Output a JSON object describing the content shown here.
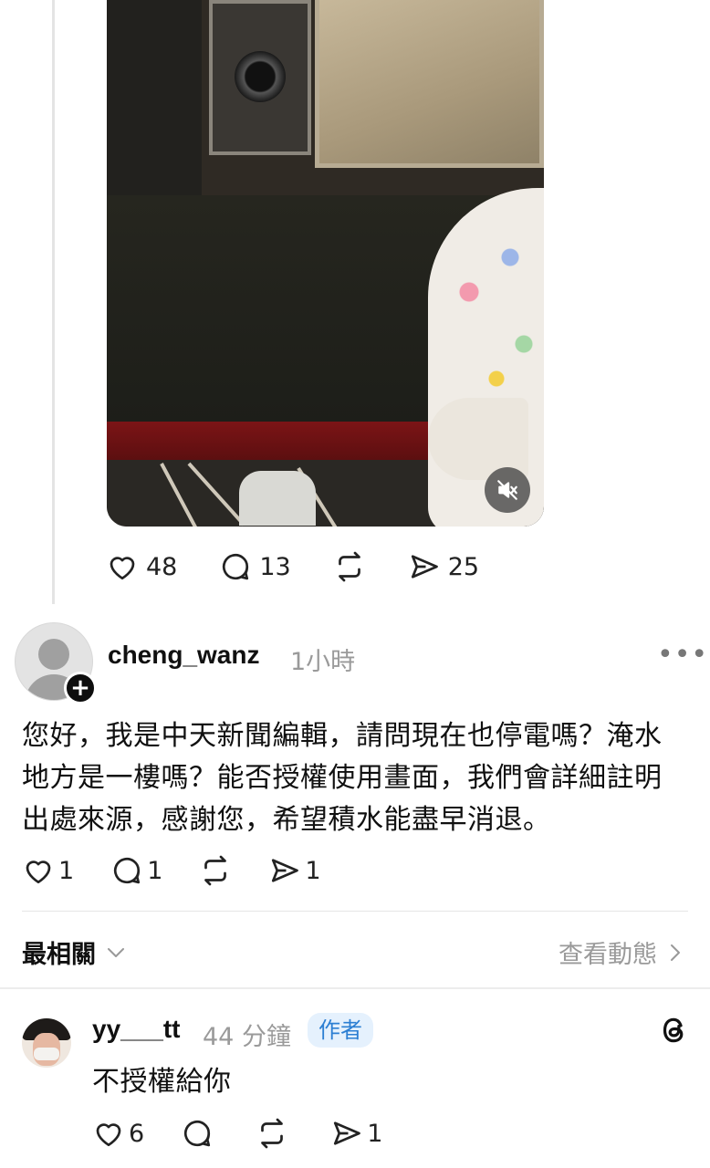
{
  "post": {
    "likes": "48",
    "comments": "13",
    "shares": "25"
  },
  "comment": {
    "username": "cheng_wanz",
    "time": "1小時",
    "more_label": "•••",
    "text": "您好，我是中天新聞編輯，請問現在也停電嗎？淹水地方是一樓嗎？能否授權使用畫面，我們會詳細註明出處來源，感謝您，希望積水能盡早消退。",
    "likes": "1",
    "comments": "1",
    "shares": "1"
  },
  "sort": {
    "label": "最相關",
    "chevron": "⌵",
    "view_activity": "查看動態",
    "view_chevron": "›"
  },
  "reply": {
    "username": "yy___tt",
    "time": "44 分鐘",
    "badge": "作者",
    "text": "不授權給你",
    "likes": "6",
    "shares": "1"
  },
  "icons": {
    "like": "heart-icon",
    "comment": "comment-bubble-icon",
    "repost": "repost-icon",
    "share": "send-icon",
    "mute": "speaker-muted-icon",
    "app": "threads-logo-icon"
  },
  "colors": {
    "author_badge_bg": "#e5f1fd",
    "author_badge_text": "#2c7fd3",
    "muted_text": "#9a9a9a"
  }
}
